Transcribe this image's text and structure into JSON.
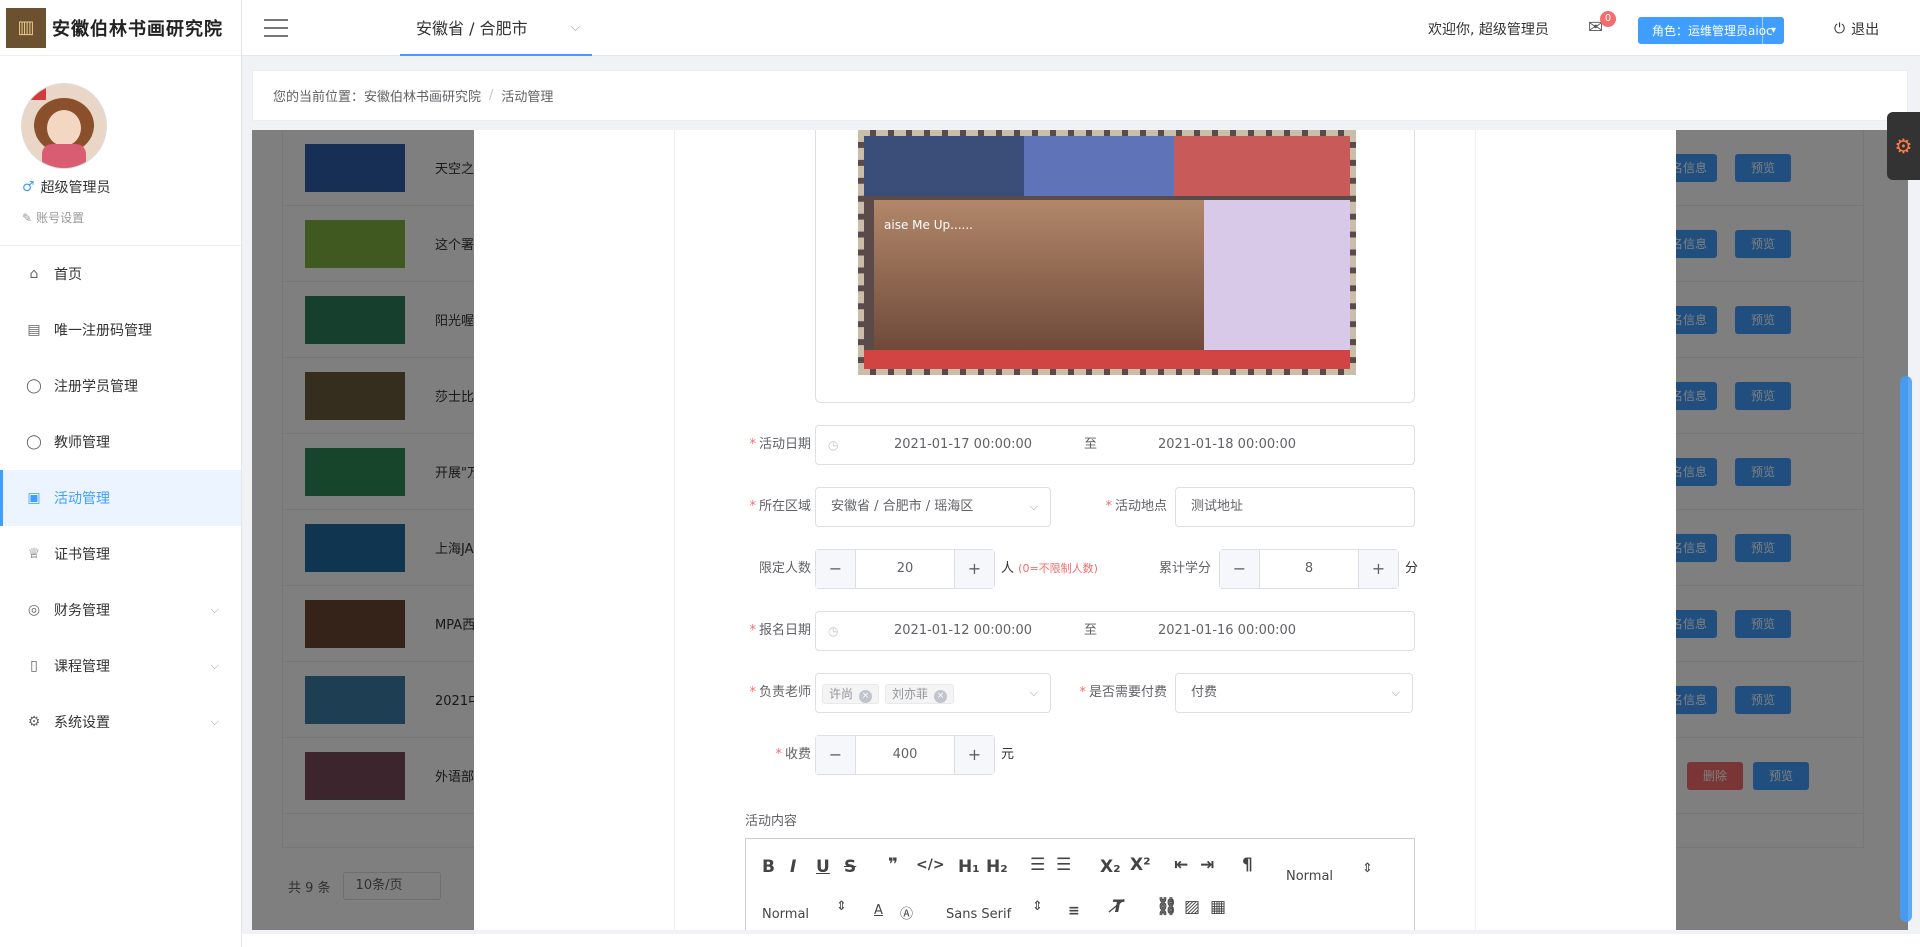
{
  "app": {
    "logo_text": "安徽伯林书画研究院"
  },
  "header": {
    "region": "安徽省 / 合肥市",
    "welcome": "欢迎你, 超级管理员",
    "mail_count": "0",
    "role": "角色：运维管理员aioc",
    "logout": "退出"
  },
  "profile": {
    "name": "超级管理员",
    "account_settings": "账号设置"
  },
  "sidebar": {
    "items": [
      {
        "label": "首页",
        "icon": "home-icon"
      },
      {
        "label": "唯一注册码管理",
        "icon": "document-icon"
      },
      {
        "label": "注册学员管理",
        "icon": "user-icon"
      },
      {
        "label": "教师管理",
        "icon": "user-icon"
      },
      {
        "label": "活动管理",
        "icon": "gift-icon",
        "active": true
      },
      {
        "label": "证书管理",
        "icon": "trophy-icon"
      },
      {
        "label": "财务管理",
        "icon": "coins-icon",
        "expandable": true
      },
      {
        "label": "课程管理",
        "icon": "book-icon",
        "expandable": true
      },
      {
        "label": "系统设置",
        "icon": "gear-icon",
        "expandable": true
      }
    ]
  },
  "breadcrumb": {
    "prefix": "您的当前位置：",
    "root": "安徽伯林书画研究院",
    "current": "活动管理"
  },
  "table": {
    "rows": [
      {
        "title": "天空之",
        "buttons": [
          "名信息",
          "预览"
        ]
      },
      {
        "title": "这个署",
        "buttons": [
          "名信息",
          "预览"
        ]
      },
      {
        "title": "阳光喔",
        "buttons": [
          "名信息",
          "预览"
        ]
      },
      {
        "title": "莎士比",
        "buttons": [
          "名信息",
          "预览"
        ]
      },
      {
        "title": "开展\"万",
        "buttons": [
          "名信息",
          "预览"
        ]
      },
      {
        "title": "上海JA",
        "buttons": [
          "名信息",
          "预览"
        ]
      },
      {
        "title": "MPA西",
        "buttons": [
          "名信息",
          "预览"
        ]
      },
      {
        "title": "2021中",
        "buttons": [
          "名信息",
          "预览"
        ]
      },
      {
        "title": "外语部",
        "buttons": [
          "删除",
          "预览"
        ]
      }
    ],
    "thumb_colors": [
      "#2f5fa8",
      "#7fb341",
      "#2f7f5a",
      "#6b5a3a",
      "#2e8b57",
      "#1f6aa0",
      "#6a4530",
      "#3d7ea6",
      "#7a4a5a"
    ],
    "total": "共 9 条",
    "page_size": "10条/页"
  },
  "form": {
    "activity_date": {
      "label": "活动日期",
      "start": "2021-01-17 00:00:00",
      "to": "至",
      "end": "2021-01-18 00:00:00"
    },
    "area": {
      "label": "所在区域",
      "value": "安徽省 / 合肥市 / 瑶海区"
    },
    "location": {
      "label": "活动地点",
      "value": "测试地址"
    },
    "limit": {
      "label": "限定人数",
      "value": "20",
      "unit": "人",
      "hint": "(0=不限制人数)"
    },
    "credits": {
      "label": "累计学分",
      "value": "8",
      "unit": "分"
    },
    "signup_date": {
      "label": "报名日期",
      "start": "2021-01-12 00:00:00",
      "to": "至",
      "end": "2021-01-16 00:00:00"
    },
    "teachers": {
      "label": "负责老师",
      "tags": [
        "许尚",
        "刘亦菲"
      ]
    },
    "need_pay": {
      "label": "是否需要付费",
      "value": "付费"
    },
    "fee": {
      "label": "收费",
      "value": "400",
      "unit": "元"
    },
    "content_label": "活动内容",
    "editor": {
      "header_select": "Normal",
      "size_select": "Normal",
      "font_select": "Sans Serif"
    },
    "poster_text": "aise Me Up......"
  },
  "colors": {
    "primary": "#409eff",
    "danger": "#f56c6c"
  }
}
